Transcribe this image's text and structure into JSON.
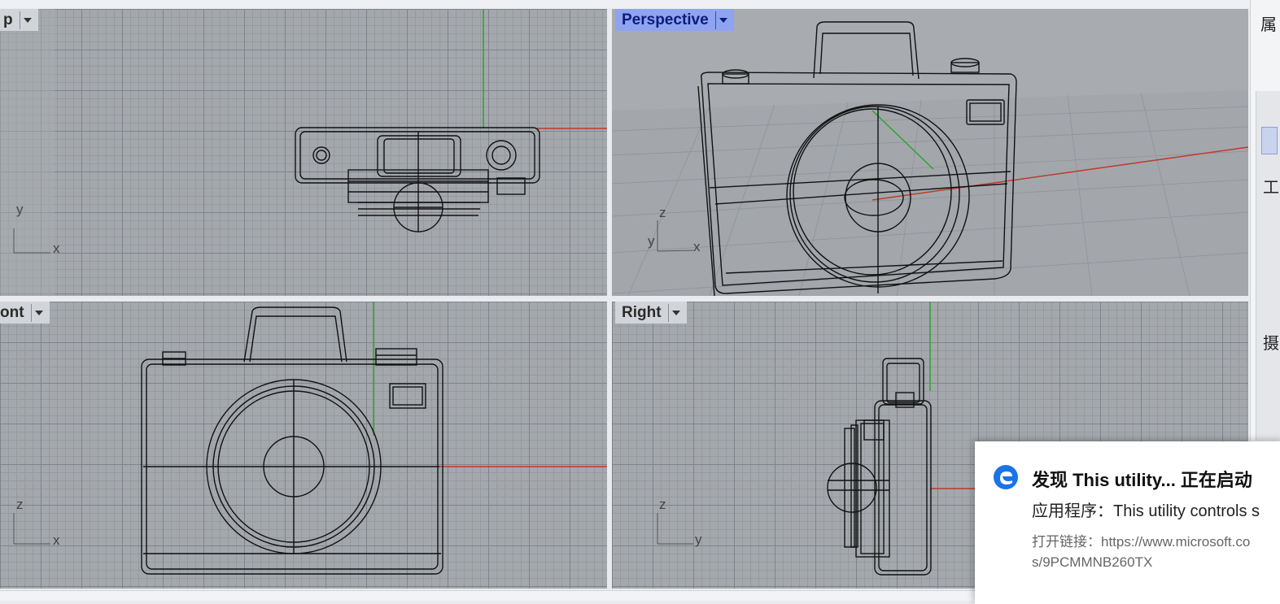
{
  "viewports": {
    "top": {
      "label": "p"
    },
    "perspective": {
      "label": "Perspective"
    },
    "front": {
      "label": "ont"
    },
    "right": {
      "label": "Right"
    }
  },
  "axis_labels": {
    "top": {
      "vertical": "y",
      "horizontal": "x"
    },
    "perspective": {
      "vertical": "z",
      "depth": "y",
      "horizontal": "x"
    },
    "front": {
      "vertical": "z",
      "horizontal": "x"
    },
    "right": {
      "vertical": "z",
      "horizontal": "y"
    }
  },
  "sidebar": {
    "title_fragment": "属",
    "item_1": "工",
    "item_2": "摄"
  },
  "notification": {
    "icon": "edge-icon",
    "title": "发现 This utility... 正在启动",
    "body": "应用程序：This utility controls s",
    "link_line1": "打开链接：https://www.microsoft.co",
    "link_line2": "s/9PCMMNB260TX"
  },
  "colors": {
    "active_tab": "#8fa4f0",
    "x_axis": "#c0392b",
    "y_axis": "#27a327",
    "edge_blue": "#1a73e8"
  }
}
